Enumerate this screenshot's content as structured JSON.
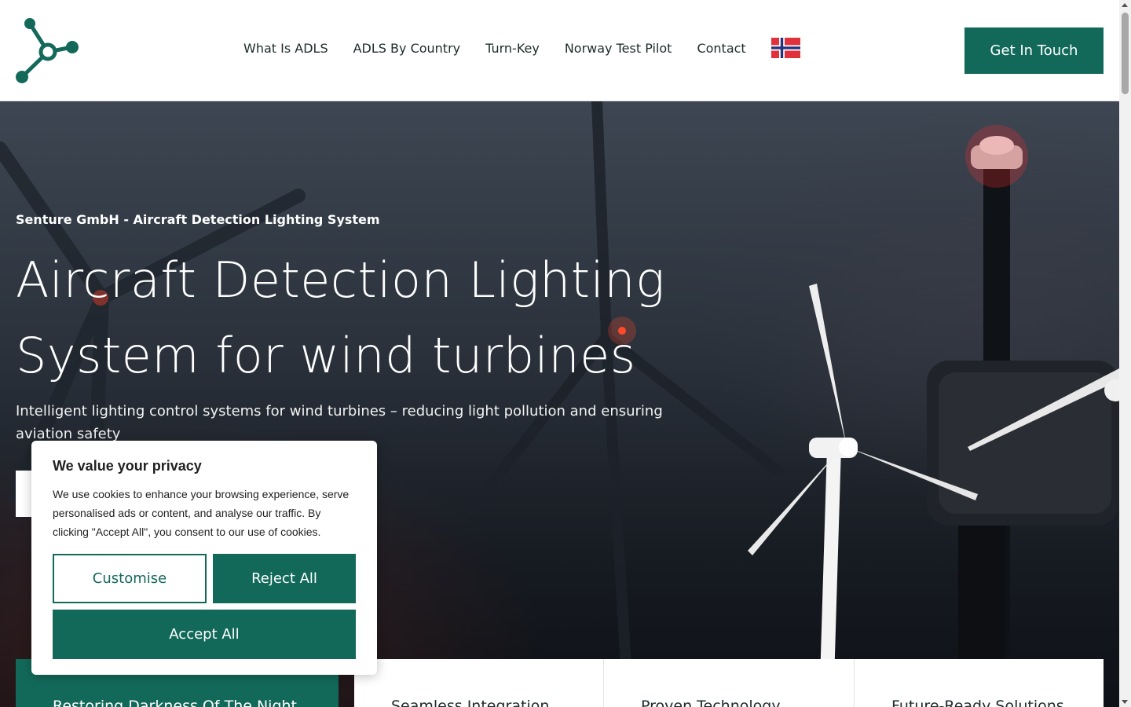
{
  "header": {
    "logo_icon": "molecule-network-logo",
    "nav": [
      {
        "label": "What Is ADLS"
      },
      {
        "label": "ADLS By Country"
      },
      {
        "label": "Turn-Key"
      },
      {
        "label": "Norway Test Pilot"
      },
      {
        "label": "Contact"
      }
    ],
    "language_flag": "norway-flag-icon",
    "cta_label": "Get In Touch"
  },
  "hero": {
    "eyebrow": "Senture GmbH - Aircraft Detection Lighting System",
    "title": "Aircraft Detection Lighting System for wind turbines",
    "subtitle": "Intelligent lighting control systems for wind turbines – reducing light pollution and ensuring aviation safety"
  },
  "features": [
    {
      "title": "Restoring Darkness Of The Night"
    },
    {
      "title": "Seamless Integration"
    },
    {
      "title": "Proven Technology"
    },
    {
      "title": "Future-Ready Solutions"
    }
  ],
  "cookie": {
    "title": "We value your privacy",
    "text": "We use cookies to enhance your browsing experience, serve personalised ads or content, and analyse our traffic. By clicking \"Accept All\", you consent to our use of cookies.",
    "customise_label": "Customise",
    "reject_label": "Reject All",
    "accept_label": "Accept All"
  },
  "colors": {
    "brand": "#12695a",
    "text_dark": "#1c2b2a",
    "white": "#ffffff"
  }
}
